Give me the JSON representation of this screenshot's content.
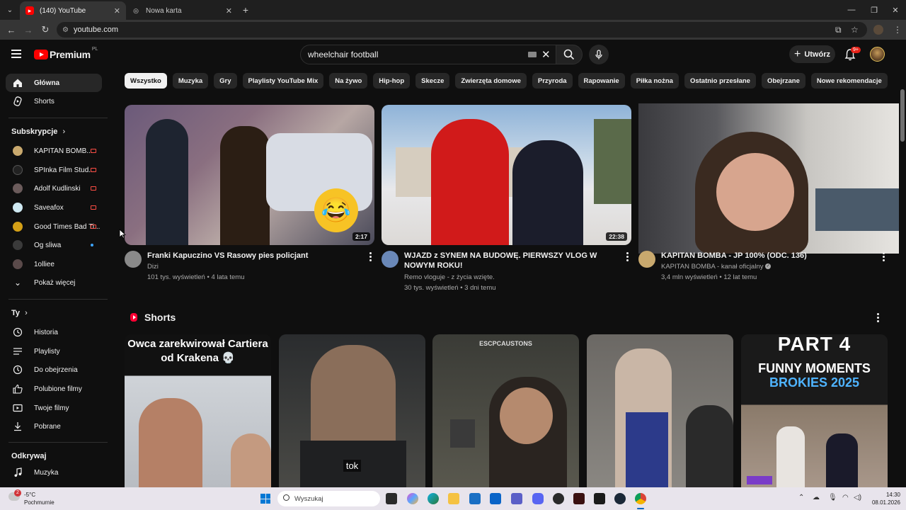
{
  "browser": {
    "tabs": [
      {
        "title": "(140) YouTube",
        "active": true
      },
      {
        "title": "Nowa karta",
        "active": false
      }
    ],
    "url": "youtube.com"
  },
  "header": {
    "logo_text": "Premium",
    "logo_region": "PL",
    "search_value": "wheelchair football",
    "create_label": "Utwórz",
    "notifications_badge": "9+"
  },
  "sidebar": {
    "main": [
      {
        "label": "Główna",
        "icon": "home-icon",
        "active": true
      },
      {
        "label": "Shorts",
        "icon": "shorts-icon",
        "active": false
      }
    ],
    "subscriptions_heading": "Subskrypcje",
    "subscriptions": [
      {
        "label": "KAPITAN BOMB...",
        "status": "live",
        "avatar_color": "#c9a96e"
      },
      {
        "label": "SPInka Film Stud...",
        "status": "live",
        "avatar_color": "#222222"
      },
      {
        "label": "Adolf Kudlinski",
        "status": "live",
        "avatar_color": "#6b5b5b"
      },
      {
        "label": "Saveafox",
        "status": "live",
        "avatar_color": "#cfe9f2"
      },
      {
        "label": "Good Times Bad Ti...",
        "status": "live",
        "avatar_color": "#d4a017"
      },
      {
        "label": "Og sliwa",
        "status": "new",
        "avatar_color": "#3a3a3a"
      },
      {
        "label": "1olliee",
        "status": "none",
        "avatar_color": "#5a4a4a"
      }
    ],
    "show_more": "Pokaż więcej",
    "you_heading": "Ty",
    "you_items": [
      {
        "label": "Historia",
        "icon": "history-icon"
      },
      {
        "label": "Playlisty",
        "icon": "playlist-icon"
      },
      {
        "label": "Do obejrzenia",
        "icon": "watch-later-icon"
      },
      {
        "label": "Polubione filmy",
        "icon": "thumbs-up-icon"
      },
      {
        "label": "Twoje filmy",
        "icon": "your-videos-icon"
      },
      {
        "label": "Pobrane",
        "icon": "download-icon"
      }
    ],
    "explore_heading": "Odkrywaj",
    "explore_items": [
      {
        "label": "Muzyka",
        "icon": "music-icon"
      }
    ]
  },
  "chips": [
    "Wszystko",
    "Muzyka",
    "Gry",
    "Playlisty YouTube Mix",
    "Na żywo",
    "Hip-hop",
    "Skecze",
    "Zwierzęta domowe",
    "Przyroda",
    "Rapowanie",
    "Piłka nożna",
    "Ostatnio przesłane",
    "Obejrzane",
    "Nowe rekomendacje"
  ],
  "videos": [
    {
      "title": "Franki Kapuczino VS Rasowy pies policjant",
      "channel": "Dizi",
      "meta": "101 tys. wyświetleń • 4 lata temu",
      "duration": "2:17"
    },
    {
      "title": "WJAZD z SYNEM NA BUDOWĘ. PIERWSZY VLOG W NOWYM ROKU!",
      "channel": "Remo vloguje - z życia wzięte.",
      "meta": "30 tys. wyświetleń • 3 dni temu",
      "duration": "22:38"
    },
    {
      "title": "KAPITAN BOMBA - JP 100% (ODC. 136)",
      "channel": "KAPITAN BOMBA - kanał oficjalny",
      "meta": "3,4 mln wyświetleń • 12 lat temu",
      "duration": ""
    }
  ],
  "shorts": {
    "heading": "Shorts",
    "items": [
      {
        "caption": "Owca zarekwirował Cartiera od Krakena 💀"
      },
      {
        "caption": "tok"
      },
      {
        "caption": "ESCPCAUSTONS"
      },
      {
        "caption": ""
      },
      {
        "caption_top": "PART 4",
        "caption_mid": "FUNNY MOMENTS",
        "caption_bottom": "BROKIES 2025"
      }
    ]
  },
  "taskbar": {
    "weather_temp": "-5°C",
    "weather_cond": "Pochmurnie",
    "weather_badge": "2",
    "search_placeholder": "Wyszukaj",
    "time": "14:30",
    "date": "08.01.2026"
  }
}
